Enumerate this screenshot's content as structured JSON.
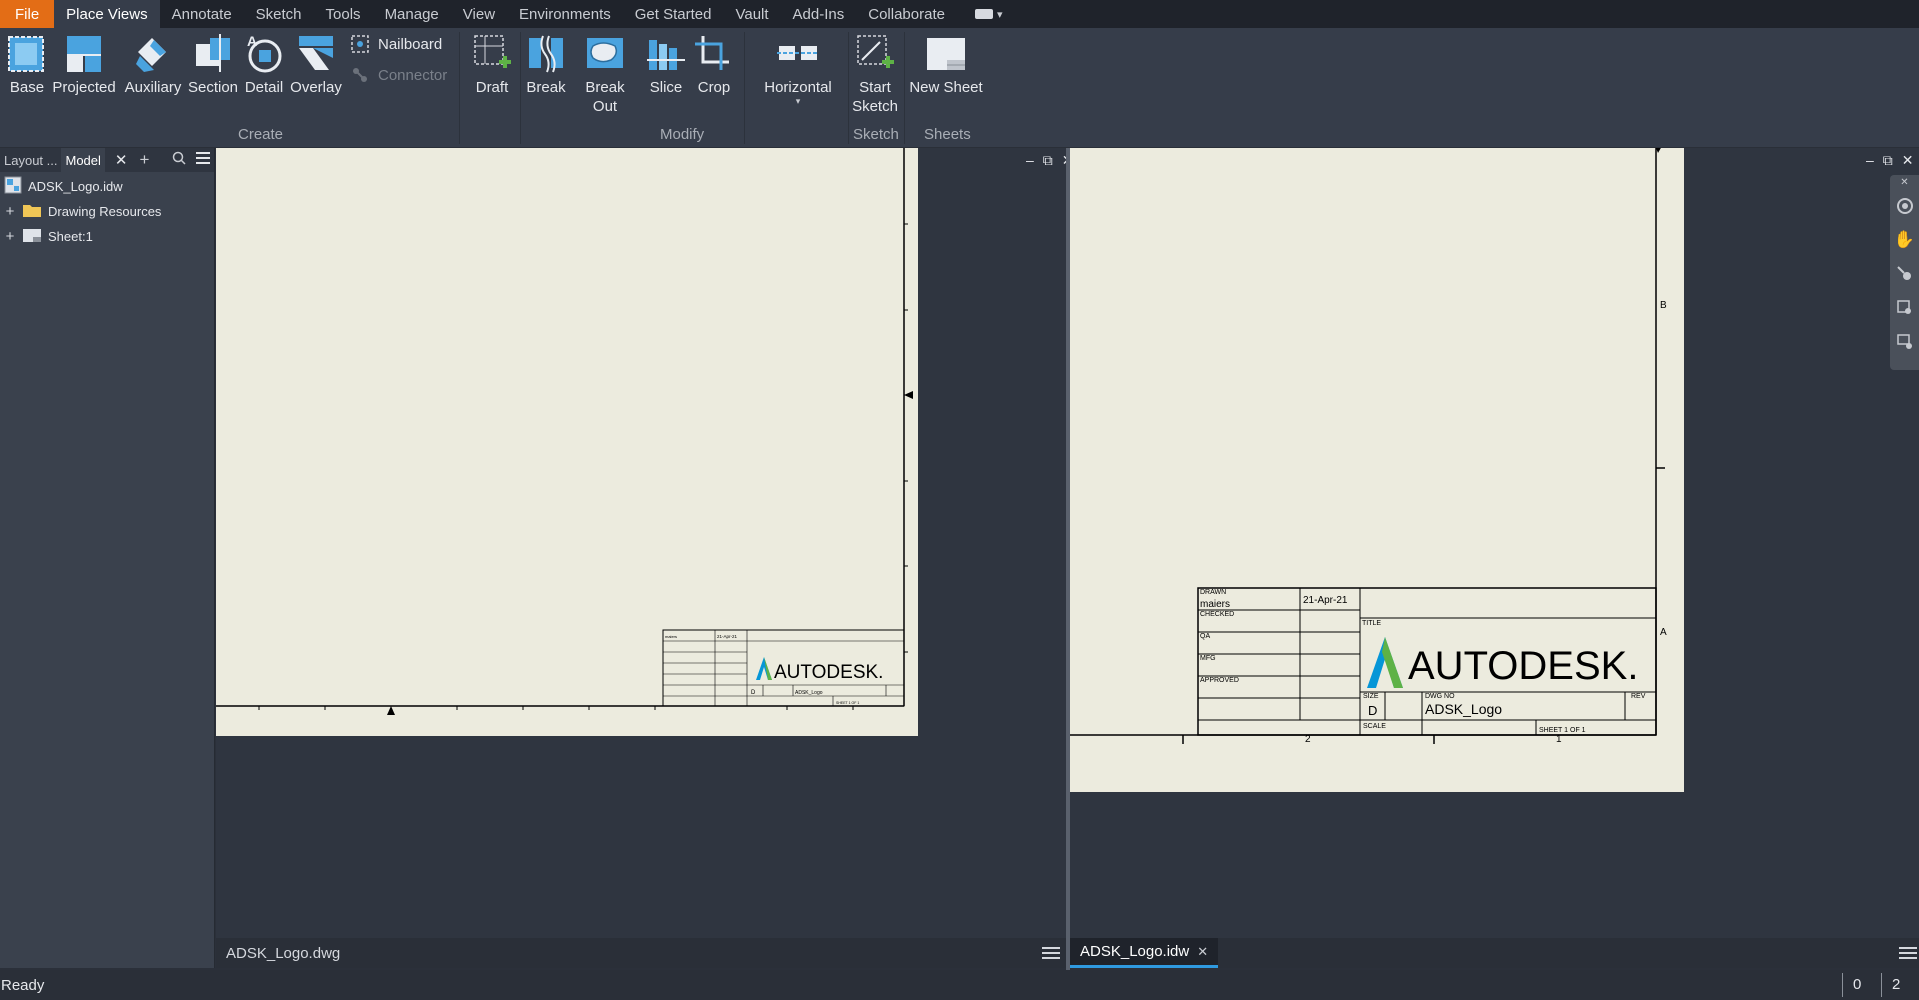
{
  "menu": {
    "file_label": "File",
    "tabs": [
      "Place Views",
      "Annotate",
      "Sketch",
      "Tools",
      "Manage",
      "View",
      "Environments",
      "Get Started",
      "Vault",
      "Add-Ins",
      "Collaborate"
    ],
    "active_tab": "Place Views"
  },
  "ribbon": {
    "create": {
      "label": "Create",
      "base": "Base",
      "projected": "Projected",
      "auxiliary": "Auxiliary",
      "section": "Section",
      "detail": "Detail",
      "overlay": "Overlay",
      "nailboard": "Nailboard",
      "connector": "Connector",
      "draft": "Draft"
    },
    "modify": {
      "label": "Modify",
      "break": "Break",
      "break_out": "Break Out",
      "slice": "Slice",
      "crop": "Crop",
      "horizontal": "Horizontal"
    },
    "sketch": {
      "label": "Sketch",
      "start_sketch_line1": "Start",
      "start_sketch_line2": "Sketch"
    },
    "sheets": {
      "label": "Sheets",
      "new_sheet": "New Sheet"
    }
  },
  "browser": {
    "tabs": [
      "Layout ...",
      "Model"
    ],
    "active_tab": "Model",
    "items": [
      {
        "label": "ADSK_Logo.idw",
        "icon": "idw-document-icon",
        "expandable": false
      },
      {
        "label": "Drawing Resources",
        "icon": "folder-icon",
        "expandable": true
      },
      {
        "label": "Sheet:1",
        "icon": "sheet-icon",
        "expandable": true
      }
    ]
  },
  "left_view": {
    "doc_tab": "ADSK_Logo.dwg",
    "title_block": {
      "date": "21-Apr-21",
      "drawn_by": "maiers",
      "size": "D",
      "dwg_no": "ADSK_Logo",
      "logo": "AUTODESK.",
      "sheet": "SHEET 1 OF 1"
    }
  },
  "right_view": {
    "doc_tab": "ADSK_Logo.idw",
    "zone_labels": [
      "B",
      "A"
    ],
    "border_numbers": [
      "2",
      "1"
    ],
    "title_block": {
      "drawn_label": "DRAWN",
      "drawn_by": "maiers",
      "date": "21-Apr-21",
      "checked_label": "CHECKED",
      "qa_label": "QA",
      "mfg_label": "MFG",
      "approved_label": "APPROVED",
      "title_label": "TITLE",
      "logo": "AUTODESK.",
      "size_label": "SIZE",
      "size": "D",
      "dwg_no_label": "DWG NO",
      "dwg_no": "ADSK_Logo",
      "rev_label": "REV",
      "scale_label": "SCALE",
      "sheet": "SHEET 1  OF 1"
    }
  },
  "status": {
    "text": "Ready",
    "count1": "0",
    "count2": "2"
  },
  "colors": {
    "file_tab": "#e36d16",
    "ribbon_bg": "#363d4a",
    "sheet_paper": "#ecebde",
    "active_tab_underline": "#2f9ae0",
    "autodesk_logo_teal": "#0696d7",
    "autodesk_logo_green": "#5eb246"
  }
}
